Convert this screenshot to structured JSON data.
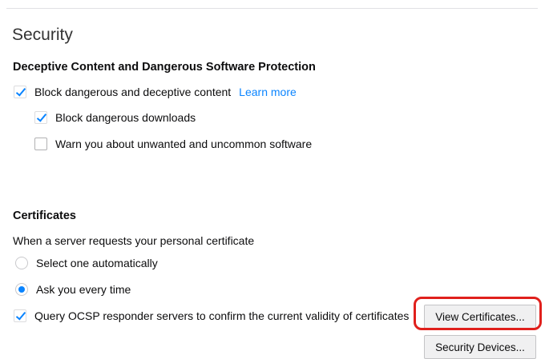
{
  "section": {
    "title": "Security"
  },
  "deceptive": {
    "heading": "Deceptive Content and Dangerous Software Protection",
    "block_content": {
      "label": "Block dangerous and deceptive content",
      "checked": true
    },
    "learn_more": "Learn more",
    "block_downloads": {
      "label": "Block dangerous downloads",
      "checked": true
    },
    "warn_unwanted": {
      "label": "Warn you about unwanted and uncommon software",
      "checked": false
    }
  },
  "certificates": {
    "heading": "Certificates",
    "prompt": "When a server requests your personal certificate",
    "option_auto": {
      "label": "Select one automatically",
      "selected": false
    },
    "option_ask": {
      "label": "Ask you every time",
      "selected": true
    },
    "ocsp": {
      "label": "Query OCSP responder servers to confirm the current validity of certificates",
      "checked": true
    },
    "view_button": "View Certificates...",
    "devices_button": "Security Devices..."
  },
  "colors": {
    "accent": "#0a84ff",
    "highlight": "#e0201c"
  }
}
